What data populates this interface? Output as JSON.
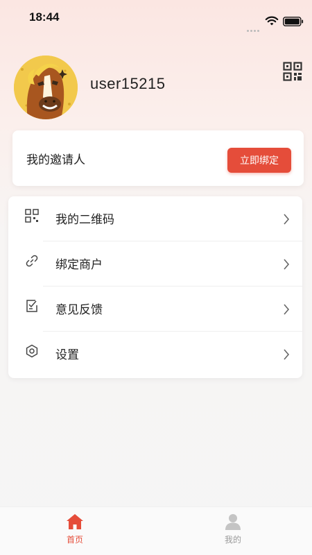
{
  "status_bar": {
    "time": "18:44"
  },
  "profile": {
    "username": "user15215"
  },
  "inviter": {
    "label": "我的邀请人",
    "button_label": "立即绑定"
  },
  "menu": {
    "items": [
      {
        "label": "我的二维码",
        "icon": "qr-code-icon"
      },
      {
        "label": "绑定商户",
        "icon": "link-icon"
      },
      {
        "label": "意见反馈",
        "icon": "feedback-icon"
      },
      {
        "label": "设置",
        "icon": "settings-icon"
      }
    ]
  },
  "tabbar": {
    "tabs": [
      {
        "label": "首页",
        "icon": "home-icon",
        "active": true
      },
      {
        "label": "我的",
        "icon": "user-icon",
        "active": false
      }
    ]
  },
  "colors": {
    "accent": "#e54d3a",
    "inactive": "#9a9a9a"
  }
}
